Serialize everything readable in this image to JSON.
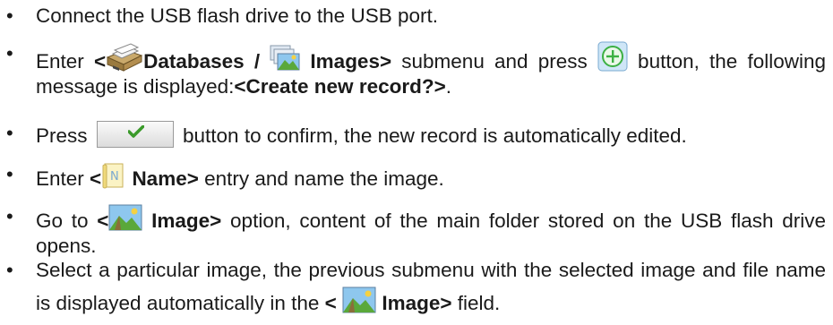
{
  "bullet": "•",
  "steps": [
    {
      "text": "Connect the USB flash drive to the USB port."
    },
    {
      "p1": "Enter ",
      "b1": "<",
      "b2": "Databases /",
      "b3": "Images>",
      "p2": " submenu and press ",
      "p3": " button, the following message is displayed:",
      "b4": "<Create new record?>",
      "p4": "."
    },
    {
      "p1": "Press ",
      "p2": " button to confirm, the new record is automatically edited."
    },
    {
      "p1": "Enter ",
      "b1": "<",
      "b2": "Name>",
      "p2": " entry and name the image."
    },
    {
      "p1": "Go to ",
      "b1": "<",
      "b2": "Image>",
      "p2": " option, content of the main folder stored on the USB flash drive opens."
    },
    {
      "p1": "Select a particular image, the previous submenu with the selected image and file name is displayed automatically in the ",
      "b1": "<",
      "b2": "Image>",
      "p2": " field."
    }
  ],
  "colors": {
    "add_icon": "#3cb043",
    "check": "#3a9a2a",
    "sky": "#8ec7ee",
    "grass": "#5aa83a"
  }
}
